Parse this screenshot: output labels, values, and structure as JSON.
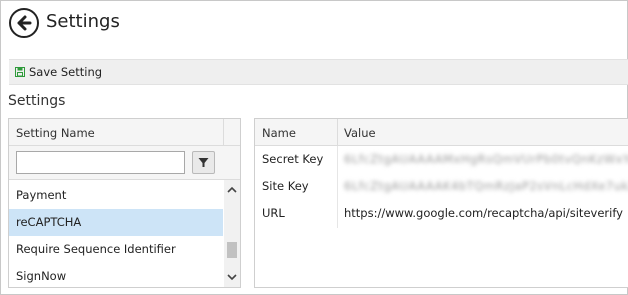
{
  "header": {
    "title": "Settings"
  },
  "toolbar": {
    "save_label": "Save Setting"
  },
  "section": {
    "title": "Settings"
  },
  "left_grid": {
    "column_header": "Setting Name",
    "filter": {
      "value": "",
      "placeholder": ""
    },
    "rows": [
      {
        "label": "Payment",
        "selected": false
      },
      {
        "label": "reCAPTCHA",
        "selected": true
      },
      {
        "label": "Require Sequence Identifier",
        "selected": false
      },
      {
        "label": "SignNow",
        "selected": false
      }
    ]
  },
  "right_grid": {
    "headers": {
      "name": "Name",
      "value": "Value"
    },
    "rows": [
      {
        "name": "Secret Key",
        "value": "6LfcZtgAUAAAAMxHgRsQmVUrPb0tvQnKzWxYa8sT",
        "blurred": true
      },
      {
        "name": "Site Key",
        "value": "6LfcZtgAUAAAAK4bTQmRzJaP2sVnLcHdXe7ukZ9b",
        "blurred": true
      },
      {
        "name": "URL",
        "value": "https://www.google.com/recaptcha/api/siteverify",
        "blurred": false
      }
    ]
  },
  "colors": {
    "selected_row": "#cde4f7",
    "save_icon": "#2e9a3a"
  }
}
